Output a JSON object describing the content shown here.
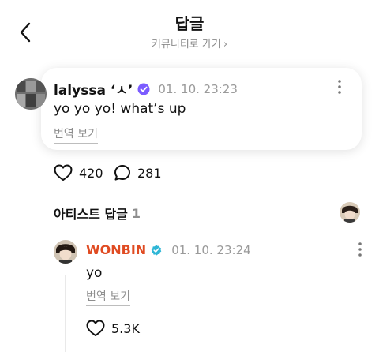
{
  "header": {
    "title": "답글",
    "community_link": "커뮤니티로 가기",
    "back_icon": "chevron-left-icon"
  },
  "post": {
    "username": "lalyssa ‘ㅅ’",
    "badge_icon": "verified-badge-icon",
    "timestamp": "01. 10. 23:23",
    "text": "yo yo yo! what’s up",
    "translate_label": "번역 보기",
    "like_count": "420",
    "comment_count": "281"
  },
  "artist_section": {
    "title": "아티스트 답글",
    "count": "1"
  },
  "artist_reply": {
    "name": "WONBIN",
    "timestamp": "01. 10. 23:24",
    "text": "yo",
    "translate_label": "번역 보기",
    "like_count": "5.3K"
  },
  "colors": {
    "artist_name": "#e04b22",
    "badge_purple": "#7b5cff",
    "artist_check": "#2eb6d6",
    "muted": "#8e8e8e"
  }
}
